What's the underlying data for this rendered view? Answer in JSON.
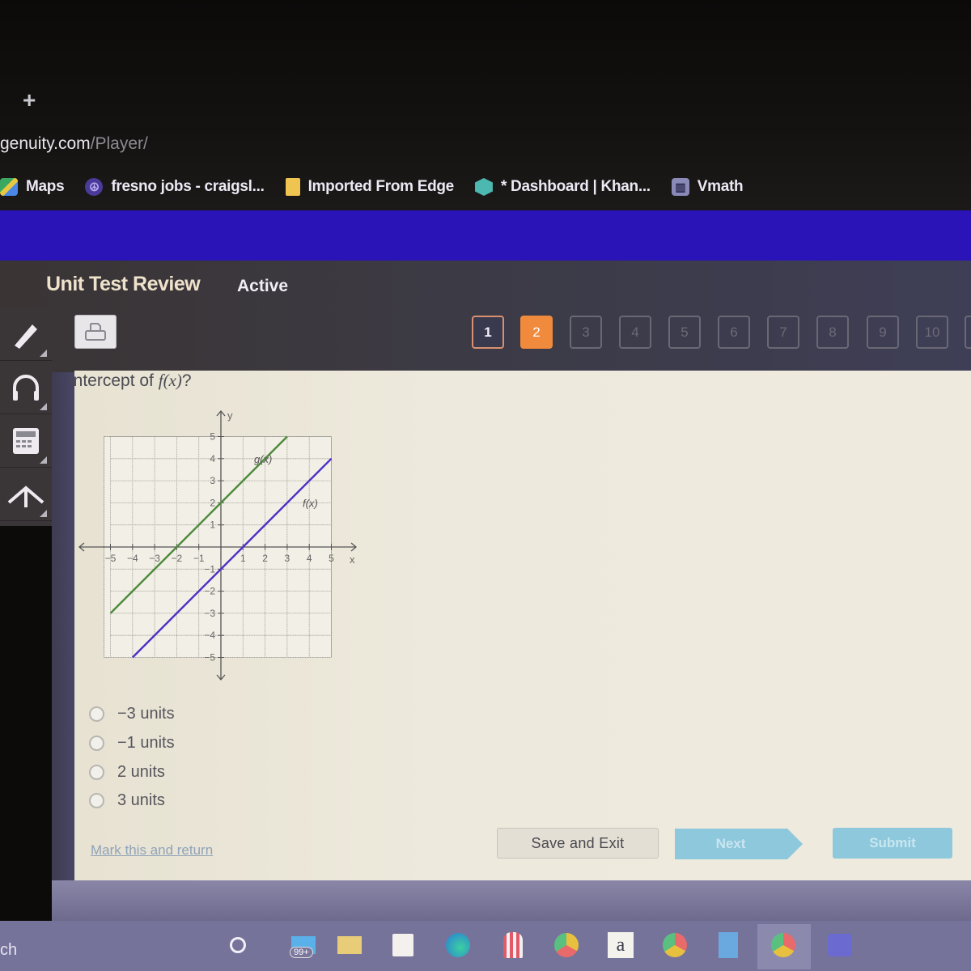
{
  "browser": {
    "new_tab_glyph": "+",
    "url_host": "genuity.com",
    "url_path": "/Player/",
    "bookmarks": [
      {
        "label": "Maps",
        "icon": "maps-icon"
      },
      {
        "label": "fresno jobs - craigsl...",
        "icon": "peace-icon"
      },
      {
        "label": "Imported From Edge",
        "icon": "folder-icon"
      },
      {
        "label": "* Dashboard | Khan...",
        "icon": "khan-academy-icon"
      },
      {
        "label": "Vmath",
        "icon": "vmath-icon"
      }
    ],
    "band_color": "#2a14b8"
  },
  "assessment": {
    "title": "Unit Test Review",
    "status": "Active",
    "print_icon": "printer-icon",
    "questions": [
      {
        "label": "1",
        "state": "done"
      },
      {
        "label": "2",
        "state": "current"
      },
      {
        "label": "3",
        "state": "pending"
      },
      {
        "label": "4",
        "state": "pending"
      },
      {
        "label": "5",
        "state": "pending"
      },
      {
        "label": "6",
        "state": "pending"
      },
      {
        "label": "7",
        "state": "pending"
      },
      {
        "label": "8",
        "state": "pending"
      },
      {
        "label": "9",
        "state": "pending"
      },
      {
        "label": "10",
        "state": "pending"
      }
    ],
    "accent_color": "#f08a3c"
  },
  "tools": [
    {
      "name": "highlighter-icon"
    },
    {
      "name": "headphones-icon"
    },
    {
      "name": "calculator-icon"
    },
    {
      "name": "reference-icon"
    }
  ],
  "question": {
    "prompt_prefix": "intercept of ",
    "prompt_fn": "f(x)",
    "prompt_suffix": "?",
    "choices": [
      {
        "label": "−3 units"
      },
      {
        "label": "−1 units"
      },
      {
        "label": "2 units"
      },
      {
        "label": "3 units"
      }
    ],
    "mark_link": "Mark this and return",
    "buttons": {
      "save_exit": "Save and Exit",
      "next": "Next",
      "submit": "Submit"
    }
  },
  "chart_data": {
    "type": "line",
    "title": "",
    "xlabel": "x",
    "ylabel": "y",
    "xlim": [
      -5,
      5
    ],
    "ylim": [
      -5,
      5
    ],
    "grid": true,
    "x_ticks": [
      "-5",
      "-4",
      "-3",
      "-2",
      "-1",
      "1",
      "2",
      "3",
      "4",
      "5"
    ],
    "y_ticks": [
      "5",
      "4",
      "3",
      "2",
      "1",
      "-1",
      "-2",
      "-3",
      "-4",
      "-5"
    ],
    "series": [
      {
        "name": "g(x)",
        "color": "#4a8a3a",
        "points": [
          [
            -5,
            -3
          ],
          [
            3,
            5
          ]
        ],
        "label_at": [
          1.5,
          4
        ]
      },
      {
        "name": "f(x)",
        "color": "#4a30c8",
        "points": [
          [
            -4,
            -5
          ],
          [
            5,
            4
          ]
        ],
        "label_at": [
          3.7,
          2
        ]
      }
    ]
  },
  "taskbar": {
    "search_text": "ch",
    "mail_badge": "99+",
    "icons": [
      "cortana-icon",
      "mail-icon",
      "file-explorer-icon",
      "store-icon",
      "edge-icon",
      "popcorn-icon",
      "chrome-canary-icon",
      "amazon-icon",
      "chrome-icon",
      "calculator-app-icon",
      "chrome-profile-icon",
      "teams-icon"
    ],
    "amazon_glyph": "a"
  }
}
